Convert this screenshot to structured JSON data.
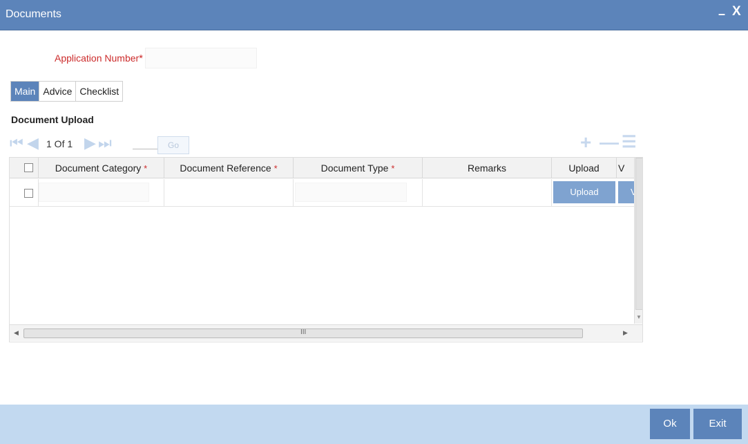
{
  "window": {
    "title": "Documents",
    "minimize": "–",
    "close": "X"
  },
  "form": {
    "application_number_label": "Application Number",
    "required_mark": "*",
    "application_number_value": ""
  },
  "tabs": [
    {
      "label": "Main",
      "active": true
    },
    {
      "label": "Advice",
      "active": false
    },
    {
      "label": "Checklist",
      "active": false
    }
  ],
  "section": {
    "title": "Document Upload"
  },
  "pager": {
    "info": "1 Of 1",
    "page_value": "",
    "go_label": "Go"
  },
  "grid": {
    "columns": [
      {
        "label": "Document Category",
        "required": "*"
      },
      {
        "label": "Document Reference",
        "required": "*"
      },
      {
        "label": "Document Type",
        "required": "*"
      },
      {
        "label": "Remarks",
        "required": ""
      },
      {
        "label": "Upload",
        "required": ""
      },
      {
        "label": "V",
        "required": ""
      }
    ],
    "rows": [
      {
        "upload_label": "Upload",
        "view_label": "View"
      }
    ],
    "hscroll_grip": "III"
  },
  "footer": {
    "ok_label": "Ok",
    "exit_label": "Exit"
  },
  "colors": {
    "accent": "#5c84ba",
    "required": "#cc2b2b",
    "footer_bg": "#c2d9f0",
    "button_light": "#7fa3d0"
  }
}
